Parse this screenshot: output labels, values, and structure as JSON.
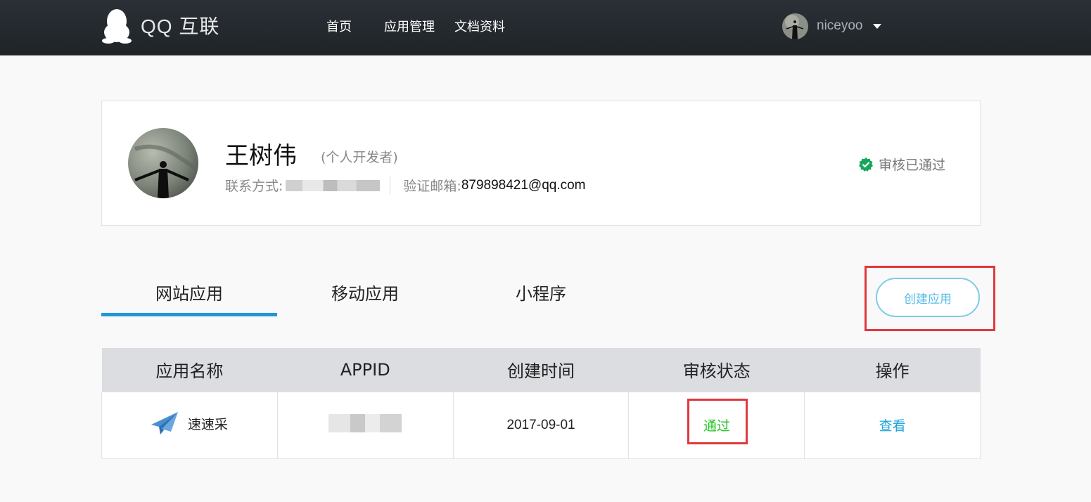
{
  "header": {
    "logo_text": "QQ 互联",
    "nav": [
      "首页",
      "应用管理",
      "文档资料"
    ],
    "username": "niceyoo"
  },
  "profile": {
    "name": "王树伟",
    "type": "(个人开发者)",
    "contact_label": "联系方式:",
    "email_label": "验证邮箱:",
    "email": "879898421@qq.com",
    "status": "审核已通过"
  },
  "tabs": [
    "网站应用",
    "移动应用",
    "小程序"
  ],
  "create_button": "创建应用",
  "table": {
    "headers": [
      "应用名称",
      "APPID",
      "创建时间",
      "审核状态",
      "操作"
    ],
    "rows": [
      {
        "name": "速速采",
        "created": "2017-09-01",
        "status": "通过",
        "action": "查看"
      }
    ]
  },
  "colors": {
    "accent": "#2196d9",
    "success": "#1fc21f",
    "link": "#1aa3d9",
    "highlight": "#e0393e"
  }
}
